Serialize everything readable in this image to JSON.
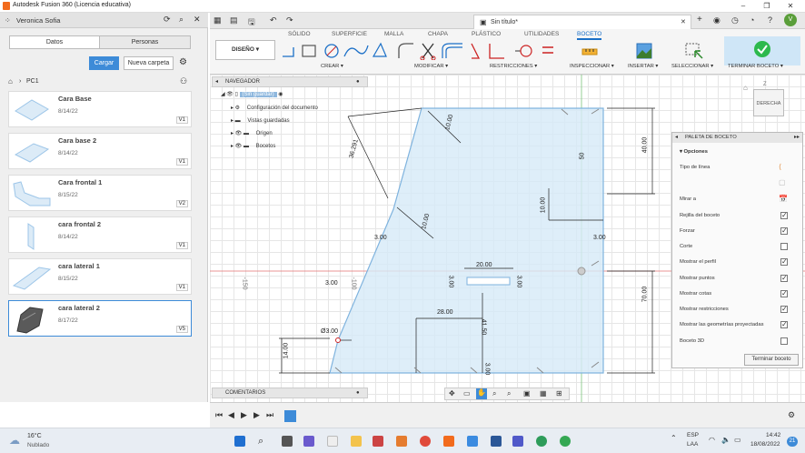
{
  "window": {
    "title": "Autodesk Fusion 360 (Licencia educativa)"
  },
  "left_panel": {
    "user": "Veronica Sofia",
    "tabs": [
      "Datos",
      "Personas"
    ],
    "upload_label": "Cargar",
    "new_folder_label": "Nueva carpeta",
    "breadcrumb": "PC1",
    "files": [
      {
        "name": "Cara Base",
        "date": "8/14/22",
        "version": "V1"
      },
      {
        "name": "Cara base 2",
        "date": "8/14/22",
        "version": "V1"
      },
      {
        "name": "Cara frontal 1",
        "date": "8/15/22",
        "version": "V2"
      },
      {
        "name": "cara frontal 2",
        "date": "8/14/22",
        "version": "V1"
      },
      {
        "name": "cara lateral 1",
        "date": "8/15/22",
        "version": "V1"
      },
      {
        "name": "cara lateral 2",
        "date": "8/17/22",
        "version": "V5"
      }
    ]
  },
  "doc_tab": {
    "title": "Sin título*"
  },
  "ribbon": {
    "tabs": [
      "SÓLIDO",
      "SUPERFICIE",
      "MALLA",
      "CHAPA",
      "PLÁSTICO",
      "UTILIDADES",
      "BOCETO"
    ],
    "active_tab": "BOCETO",
    "workspace": "DISEÑO",
    "groups": [
      "CREAR",
      "MODIFICAR",
      "RESTRICCIONES",
      "INSPECCIONAR",
      "INSERTAR",
      "SELECCIONAR",
      "TERMINAR BOCETO"
    ]
  },
  "navigator": {
    "title": "NAVEGADOR",
    "root": "(Sin guardar)",
    "items": [
      "Configuración del documento",
      "Vistas guardadas",
      "Origen",
      "Bocetos"
    ]
  },
  "viewcube": {
    "face": "DERECHA",
    "axis": "Z"
  },
  "palette": {
    "title": "PALETA DE BOCETO",
    "section": "Opciones",
    "rows": [
      {
        "label": "Tipo de línea",
        "checked": null
      },
      {
        "label": "Mirar a",
        "checked": null
      },
      {
        "label": "Rejilla del boceto",
        "checked": true
      },
      {
        "label": "Forzar",
        "checked": true
      },
      {
        "label": "Corte",
        "checked": false
      },
      {
        "label": "Mostrar el perfil",
        "checked": true
      },
      {
        "label": "Mostrar puntos",
        "checked": true
      },
      {
        "label": "Mostrar cotas",
        "checked": true
      },
      {
        "label": "Mostrar restricciones",
        "checked": true
      },
      {
        "label": "Mostrar las geometrías proyectadas",
        "checked": true
      },
      {
        "label": "Boceto 3D",
        "checked": false
      }
    ],
    "finish_label": "Terminar boceto"
  },
  "dimensions": [
    "36.291",
    "10.00",
    "10.00",
    "3.00",
    "40.00",
    "50",
    "10.00",
    "3.00",
    "20.00",
    "3.00",
    "3.00",
    "70.00",
    "28.00",
    "41.50",
    "3.00",
    "Ø3.00",
    "14.00",
    "3.00",
    "-150",
    "-100"
  ],
  "comments": {
    "label": "COMENTARIOS"
  },
  "taskbar": {
    "weather_temp": "16°C",
    "weather_desc": "Nublado",
    "lang": "ESP",
    "lang2": "LAA",
    "time": "14:42",
    "date": "18/08/2022",
    "badge": "21"
  }
}
